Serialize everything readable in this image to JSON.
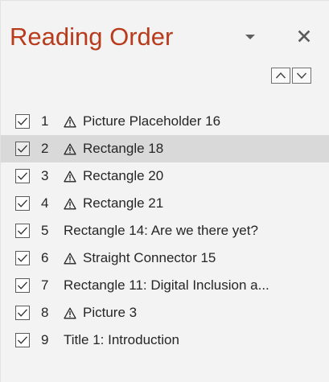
{
  "pane": {
    "title": "Reading Order",
    "accent_color": "#b83b1b",
    "options_icon": "chevron-down-icon",
    "close_icon": "close-icon"
  },
  "reorder": {
    "move_up_icon": "chevron-up-icon",
    "move_down_icon": "chevron-down-icon"
  },
  "items": [
    {
      "number": "1",
      "warning": true,
      "label": "Picture Placeholder 16",
      "checked": true,
      "selected": false
    },
    {
      "number": "2",
      "warning": true,
      "label": "Rectangle 18",
      "checked": true,
      "selected": true
    },
    {
      "number": "3",
      "warning": true,
      "label": "Rectangle 20",
      "checked": true,
      "selected": false
    },
    {
      "number": "4",
      "warning": true,
      "label": "Rectangle 21",
      "checked": true,
      "selected": false
    },
    {
      "number": "5",
      "warning": false,
      "label": "Rectangle 14: Are we there yet?",
      "checked": true,
      "selected": false
    },
    {
      "number": "6",
      "warning": true,
      "label": "Straight Connector 15",
      "checked": true,
      "selected": false
    },
    {
      "number": "7",
      "warning": false,
      "label": "Rectangle 11: Digital Inclusion a...",
      "checked": true,
      "selected": false
    },
    {
      "number": "8",
      "warning": true,
      "label": "Picture 3",
      "checked": true,
      "selected": false
    },
    {
      "number": "9",
      "warning": false,
      "label": "Title 1: Introduction",
      "checked": true,
      "selected": false
    }
  ]
}
